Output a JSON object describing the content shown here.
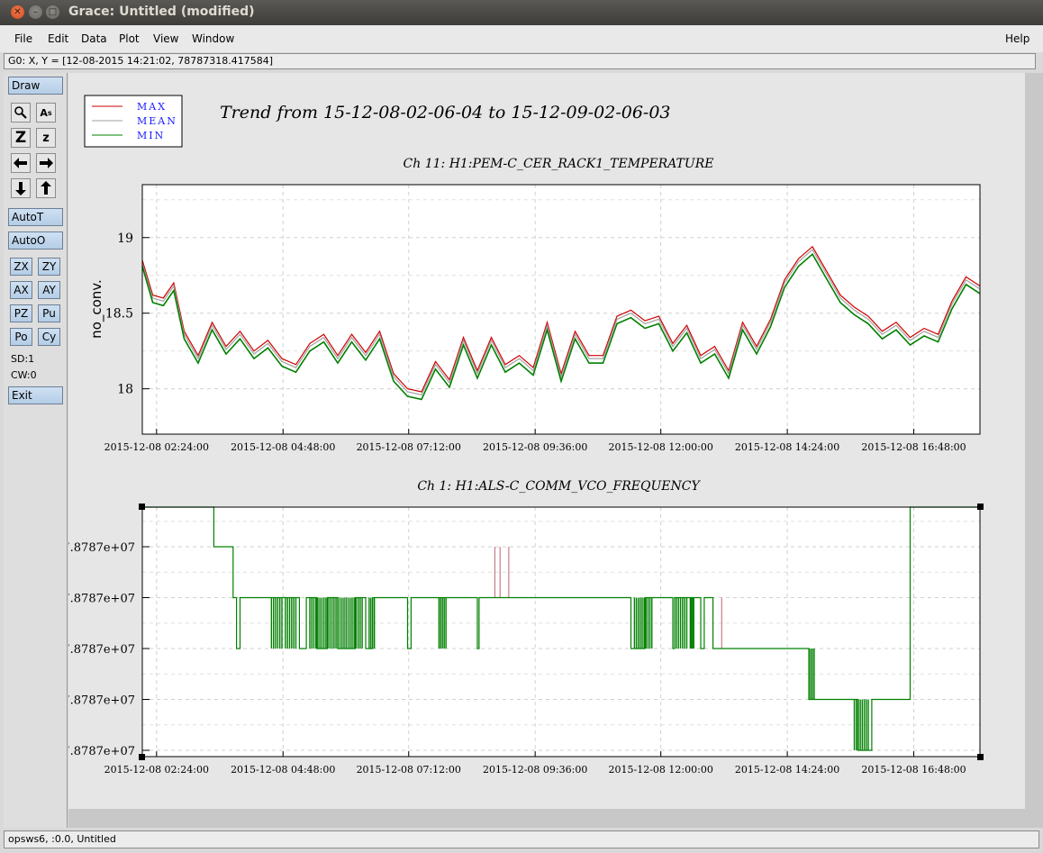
{
  "window": {
    "title": "Grace: Untitled (modified)"
  },
  "menu": {
    "file": "File",
    "edit": "Edit",
    "data": "Data",
    "plot": "Plot",
    "view": "View",
    "window": "Window",
    "help": "Help"
  },
  "coord_readout": "G0: X, Y = [12-08-2015 14:21:02, 78787318.417584]",
  "toolbar": {
    "draw": "Draw",
    "autot": "AutoT",
    "autoo": "AutoO",
    "zx": "ZX",
    "zy": "ZY",
    "ax": "AX",
    "ay": "AY",
    "pz": "PZ",
    "pu": "Pu",
    "po": "Po",
    "cy": "Cy",
    "sd": "SD:1",
    "cw": "CW:0",
    "exit": "Exit",
    "zoom_big": "Z",
    "zoom_small": "z",
    "text_icon": "A"
  },
  "status": "opsws6, :0.0, Untitled",
  "page_title": "Trend from 15-12-08-02-06-04 to 15-12-09-02-06-03",
  "legend": [
    {
      "label": "MAX",
      "color": "#d00000"
    },
    {
      "label": "MEAN",
      "color": "#a0a0a0"
    },
    {
      "label": "MIN",
      "color": "#008000"
    }
  ],
  "legend_text_color": "#1a1aff",
  "chart_data": [
    {
      "type": "line",
      "title": "Ch 11: H1:PEM-C_CER_RACK1_TEMPERATURE",
      "ylabel": "no_conv.",
      "ylim": [
        17.7,
        19.35
      ],
      "yticks": [
        18,
        18.5,
        19
      ],
      "ytick_labels": [
        "18",
        "18.5",
        "19"
      ],
      "xticks": [
        "2015-12-08 02:24:00",
        "2015-12-08 04:48:00",
        "2015-12-08 07:12:00",
        "2015-12-08 09:36:00",
        "2015-12-08 12:00:00",
        "2015-12-08 14:24:00",
        "2015-12-08 16:48:00"
      ],
      "x_hours": [
        0.0,
        0.3,
        0.6,
        0.9,
        1.2,
        1.6,
        2.0,
        2.4,
        2.8,
        3.2,
        3.6,
        4.0,
        4.4,
        4.8,
        5.2,
        5.6,
        6.0,
        6.4,
        6.8,
        7.2,
        7.6,
        8.0,
        8.4,
        8.8,
        9.2,
        9.6,
        10.0,
        10.4,
        10.8,
        11.2,
        11.6,
        12.0,
        12.4,
        12.8,
        13.2,
        13.6,
        14.0,
        14.4,
        14.8,
        15.2,
        15.6,
        16.0,
        16.4,
        16.8,
        17.2,
        17.6,
        18.0,
        18.4,
        18.8,
        19.2,
        19.6,
        20.0,
        20.4,
        20.8,
        21.2,
        21.6,
        22.0,
        22.4,
        22.8,
        23.2,
        23.6,
        24.0
      ],
      "series": [
        {
          "name": "MAX",
          "values": [
            18.85,
            18.62,
            18.6,
            18.7,
            18.38,
            18.22,
            18.44,
            18.28,
            18.38,
            18.25,
            18.32,
            18.2,
            18.16,
            18.3,
            18.36,
            18.22,
            18.36,
            18.24,
            18.38,
            18.1,
            18.0,
            17.98,
            18.18,
            18.06,
            18.34,
            18.12,
            18.34,
            18.16,
            18.22,
            18.14,
            18.44,
            18.1,
            18.38,
            18.22,
            18.22,
            18.48,
            18.52,
            18.45,
            18.48,
            18.3,
            18.42,
            18.22,
            18.28,
            18.12,
            18.44,
            18.28,
            18.46,
            18.72,
            18.86,
            18.94,
            18.78,
            18.62,
            18.54,
            18.48,
            18.38,
            18.44,
            18.34,
            18.4,
            18.36,
            18.58,
            18.74,
            18.68
          ]
        },
        {
          "name": "MEAN",
          "values": [
            18.83,
            18.6,
            18.58,
            18.68,
            18.36,
            18.2,
            18.42,
            18.26,
            18.36,
            18.23,
            18.3,
            18.18,
            18.14,
            18.28,
            18.34,
            18.2,
            18.34,
            18.22,
            18.36,
            18.08,
            17.98,
            17.96,
            18.16,
            18.04,
            18.32,
            18.1,
            18.32,
            18.14,
            18.2,
            18.12,
            18.42,
            18.08,
            18.36,
            18.2,
            18.2,
            18.46,
            18.5,
            18.43,
            18.46,
            18.28,
            18.4,
            18.2,
            18.26,
            18.1,
            18.42,
            18.26,
            18.44,
            18.7,
            18.84,
            18.92,
            18.76,
            18.6,
            18.52,
            18.46,
            18.36,
            18.42,
            18.32,
            18.38,
            18.34,
            18.56,
            18.72,
            18.66
          ]
        },
        {
          "name": "MIN",
          "values": [
            18.81,
            18.57,
            18.55,
            18.65,
            18.33,
            18.17,
            18.39,
            18.23,
            18.33,
            18.2,
            18.27,
            18.15,
            18.11,
            18.25,
            18.31,
            18.17,
            18.31,
            18.19,
            18.33,
            18.05,
            17.95,
            17.93,
            18.13,
            18.01,
            18.29,
            18.07,
            18.29,
            18.11,
            18.17,
            18.09,
            18.39,
            18.05,
            18.33,
            18.17,
            18.17,
            18.43,
            18.47,
            18.4,
            18.43,
            18.25,
            18.37,
            18.17,
            18.23,
            18.07,
            18.39,
            18.23,
            18.41,
            18.67,
            18.81,
            18.89,
            18.73,
            18.57,
            18.49,
            18.43,
            18.33,
            18.39,
            18.29,
            18.35,
            18.31,
            18.53,
            18.69,
            18.63
          ]
        }
      ]
    },
    {
      "type": "line",
      "title": "Ch 1: H1:ALS-C_COMM_VCO_FREQUENCY",
      "ylabel": "",
      "ylim": [
        0,
        5
      ],
      "ytick_labels": [
        "7.8787e+07",
        "7.8787e+07",
        "7.8787e+07",
        "7.8787e+07",
        "7.8787e+07"
      ],
      "xticks": [
        "2015-12-08 02:24:00",
        "2015-12-08 04:48:00",
        "2015-12-08 07:12:00",
        "2015-12-08 09:36:00",
        "2015-12-08 12:00:00",
        "2015-12-08 14:24:00",
        "2015-12-08 16:48:00"
      ],
      "note_units": "level index (tick labels all print 7.8787e+07)",
      "min_steps_hours": [
        [
          0.0,
          5.0
        ],
        [
          2.0,
          5.0
        ],
        [
          2.05,
          4.0
        ],
        [
          2.6,
          3.0
        ],
        [
          2.7,
          2.0
        ],
        [
          2.8,
          3.0
        ],
        [
          4.0,
          3.0
        ],
        [
          4.5,
          2.0
        ],
        [
          4.7,
          3.0
        ],
        [
          5.0,
          2.0
        ],
        [
          5.3,
          3.0
        ],
        [
          5.6,
          2.0
        ],
        [
          6.1,
          3.0
        ],
        [
          6.4,
          2.0
        ],
        [
          6.6,
          3.0
        ],
        [
          7.6,
          2.0
        ],
        [
          7.7,
          3.0
        ],
        [
          9.6,
          2.0
        ],
        [
          9.65,
          3.0
        ],
        [
          13.8,
          3.0
        ],
        [
          14.0,
          2.0
        ],
        [
          14.4,
          3.0
        ],
        [
          15.2,
          2.0
        ],
        [
          15.25,
          3.0
        ],
        [
          16.0,
          2.0
        ],
        [
          16.1,
          3.0
        ],
        [
          16.35,
          2.0
        ],
        [
          18.5,
          2.0
        ],
        [
          19.1,
          1.0
        ],
        [
          19.4,
          1.0
        ],
        [
          19.7,
          1.0
        ],
        [
          20.2,
          1.0
        ],
        [
          20.5,
          0.0
        ],
        [
          20.9,
          1.0
        ],
        [
          22.0,
          2.0
        ],
        [
          22.0,
          5.0
        ],
        [
          24.0,
          5.0
        ]
      ],
      "min_dense_hours": [
        [
          3.7,
          4.0,
          3.0,
          2.0
        ],
        [
          4.1,
          4.4,
          3.0,
          2.0
        ],
        [
          4.8,
          6.3,
          3.0,
          2.0
        ],
        [
          6.5,
          6.65,
          3.0,
          2.0
        ],
        [
          8.5,
          8.7,
          3.0,
          2.0
        ],
        [
          14.1,
          14.6,
          3.0,
          2.0
        ],
        [
          15.3,
          15.6,
          3.0,
          2.0
        ],
        [
          15.7,
          15.8,
          3.0,
          2.0
        ],
        [
          19.1,
          19.25,
          2.0,
          1.0
        ],
        [
          20.4,
          20.8,
          1.0,
          0.0
        ]
      ],
      "max_spikes_hours": [
        [
          10.1,
          3.0,
          4.0
        ],
        [
          10.25,
          3.0,
          4.0
        ],
        [
          10.5,
          3.0,
          4.0
        ],
        [
          16.6,
          3.0,
          2.0
        ]
      ]
    }
  ]
}
